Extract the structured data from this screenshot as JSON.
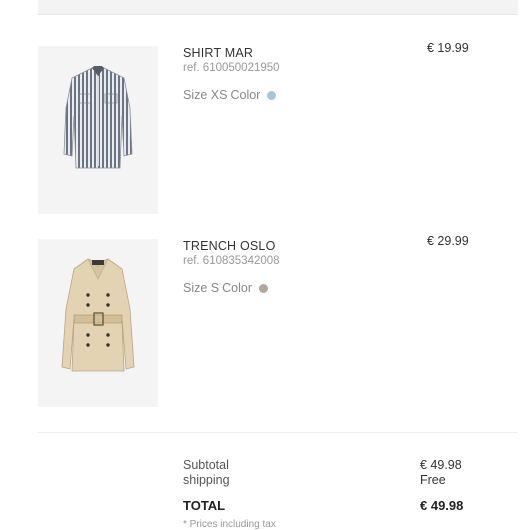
{
  "cart": {
    "items": [
      {
        "name": "SHIRT MAR",
        "ref": "ref. 610050021950",
        "size_label": "Size XS",
        "color_label": "Color",
        "swatch": "#a9c4d6",
        "price": "€ 19.99",
        "image": "striped-shirt-image"
      },
      {
        "name": "TRENCH OSLO",
        "ref": "ref. 610835342008",
        "size_label": "Size S",
        "color_label": "Color",
        "swatch": "#b1a79c",
        "price": "€ 29.99",
        "image": "beige-trench-coat-image"
      }
    ]
  },
  "summary": {
    "subtotal_label": "Subtotal",
    "subtotal_value": "€ 49.98",
    "shipping_label": "shipping",
    "shipping_value": "Free",
    "total_label": "TOTAL",
    "total_value": "€ 49.98",
    "note": "* Prices including tax"
  }
}
